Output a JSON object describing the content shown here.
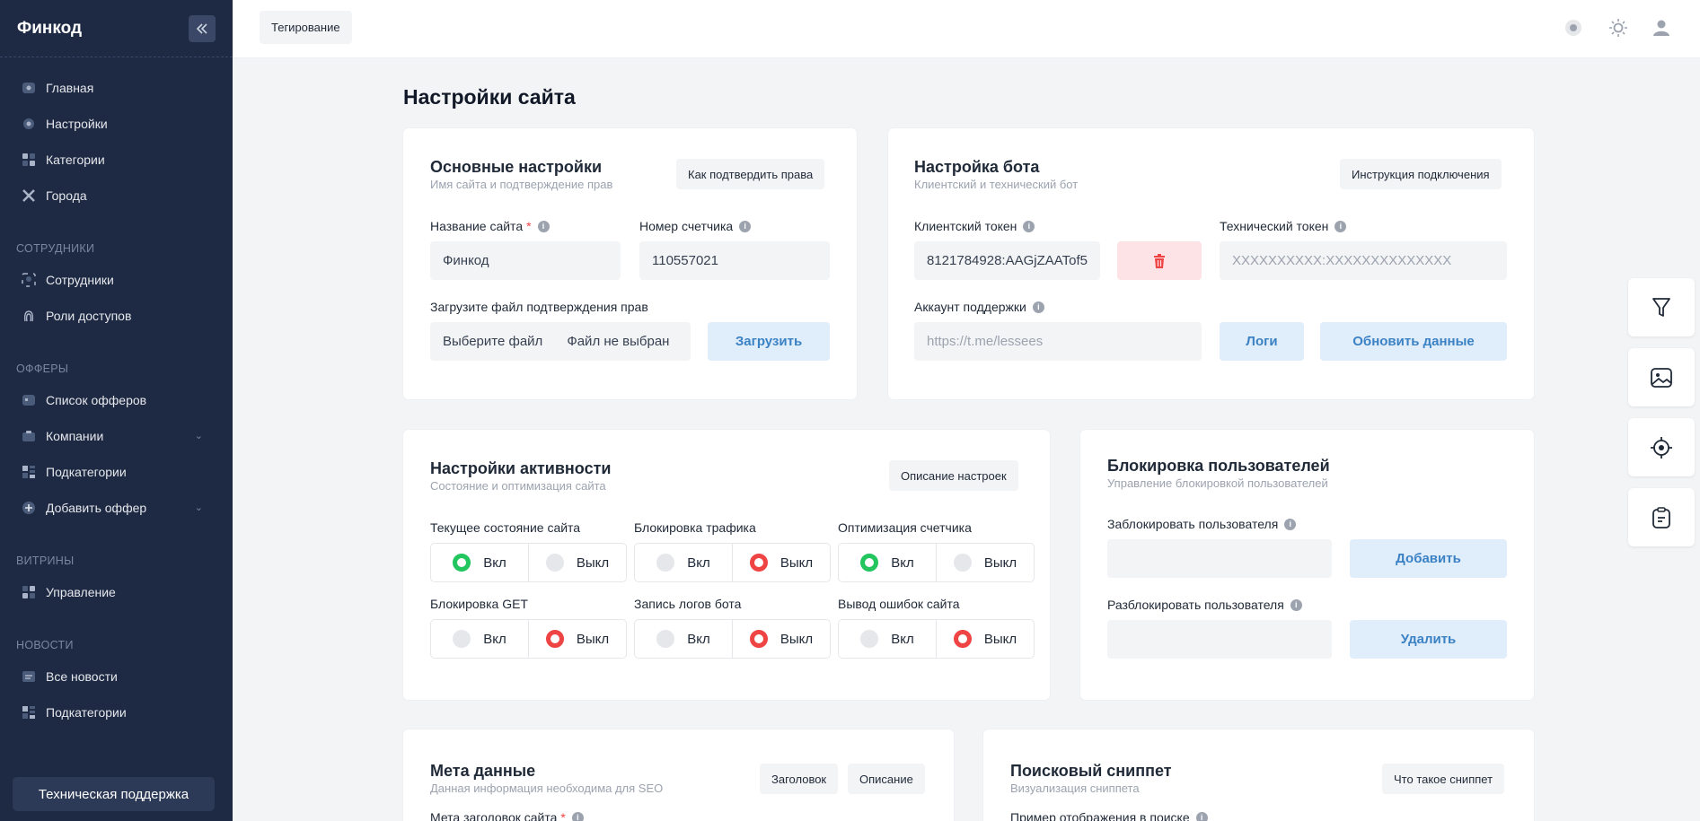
{
  "sidebar": {
    "brand": "Финкод",
    "main_items": [
      {
        "label": "Главная",
        "icon": "home-icon"
      },
      {
        "label": "Настройки",
        "icon": "gear-icon"
      },
      {
        "label": "Категории",
        "icon": "categories-icon"
      },
      {
        "label": "Города",
        "icon": "city-icon"
      }
    ],
    "sections": [
      {
        "title": "СОТРУДНИКИ",
        "items": [
          {
            "label": "Сотрудники"
          },
          {
            "label": "Роли доступов"
          }
        ]
      },
      {
        "title": "ОФФЕРЫ",
        "items": [
          {
            "label": "Список офферов"
          },
          {
            "label": "Компании"
          },
          {
            "label": "Подкатегории"
          },
          {
            "label": "Добавить оффер"
          }
        ]
      },
      {
        "title": "ВИТРИНЫ",
        "items": [
          {
            "label": "Управление"
          }
        ]
      },
      {
        "title": "НОВОСТИ",
        "items": [
          {
            "label": "Все новости"
          },
          {
            "label": "Подкатегории"
          }
        ]
      }
    ],
    "support_label": "Техническая поддержка"
  },
  "topbar": {
    "tag_label": "Тегирование"
  },
  "page": {
    "title": "Настройки сайта"
  },
  "basic": {
    "title": "Основные настройки",
    "subtitle": "Имя сайта и подтверждение прав",
    "help_btn": "Как подтвердить права",
    "site_name_label": "Название сайта",
    "site_name_value": "Финкод",
    "counter_label": "Номер счетчика",
    "counter_value": "110557021",
    "upload_label": "Загрузите файл подтверждения прав",
    "choose_file": "Выберите файл",
    "no_file": "Файл не выбран",
    "upload_btn": "Загрузить"
  },
  "bot": {
    "title": "Настройка бота",
    "subtitle": "Клиентский и технический бот",
    "help_btn": "Инструкция подключения",
    "client_token_label": "Клиентский токен",
    "client_token_value": "8121784928:AAGjZAATof5",
    "tech_token_label": "Технический токен",
    "tech_token_placeholder": "XXXXXXXXXX:XXXXXXXXXXXXXX",
    "support_label": "Аккаунт поддержки",
    "support_placeholder": "https://t.me/lessees",
    "logs_btn": "Логи",
    "update_btn": "Обновить данные"
  },
  "activity": {
    "title": "Настройки активности",
    "subtitle": "Состояние и оптимизация сайта",
    "help_btn": "Описание настроек",
    "on": "Вкл",
    "off": "Выкл",
    "toggles": [
      {
        "label": "Текущее состояние сайта",
        "state": "on"
      },
      {
        "label": "Блокировка трафика",
        "state": "off"
      },
      {
        "label": "Оптимизация счетчика",
        "state": "on"
      },
      {
        "label": "Блокировка GET",
        "state": "off"
      },
      {
        "label": "Запись логов бота",
        "state": "off"
      },
      {
        "label": "Вывод ошибок сайта",
        "state": "off"
      }
    ]
  },
  "block": {
    "title": "Блокировка пользователей",
    "subtitle": "Управление блокировкой пользователей",
    "block_label": "Заблокировать пользователя",
    "add_btn": "Добавить",
    "unblock_label": "Разблокировать пользователя",
    "delete_btn": "Удалить"
  },
  "meta": {
    "title": "Мета данные",
    "subtitle": "Данная информация необходима для SEO",
    "title_btn": "Заголовок",
    "desc_btn": "Описание",
    "meta_title_label": "Мета заголовок сайта"
  },
  "snippet": {
    "title": "Поисковый сниппет",
    "subtitle": "Визуализация сниппета",
    "help_btn": "Что такое сниппет",
    "example_label": "Пример отображения в поиске"
  },
  "colors": {
    "sidebar": "#1e2a44",
    "accent": "#3b82c4",
    "on": "#22c55e",
    "off": "#ef4444"
  }
}
